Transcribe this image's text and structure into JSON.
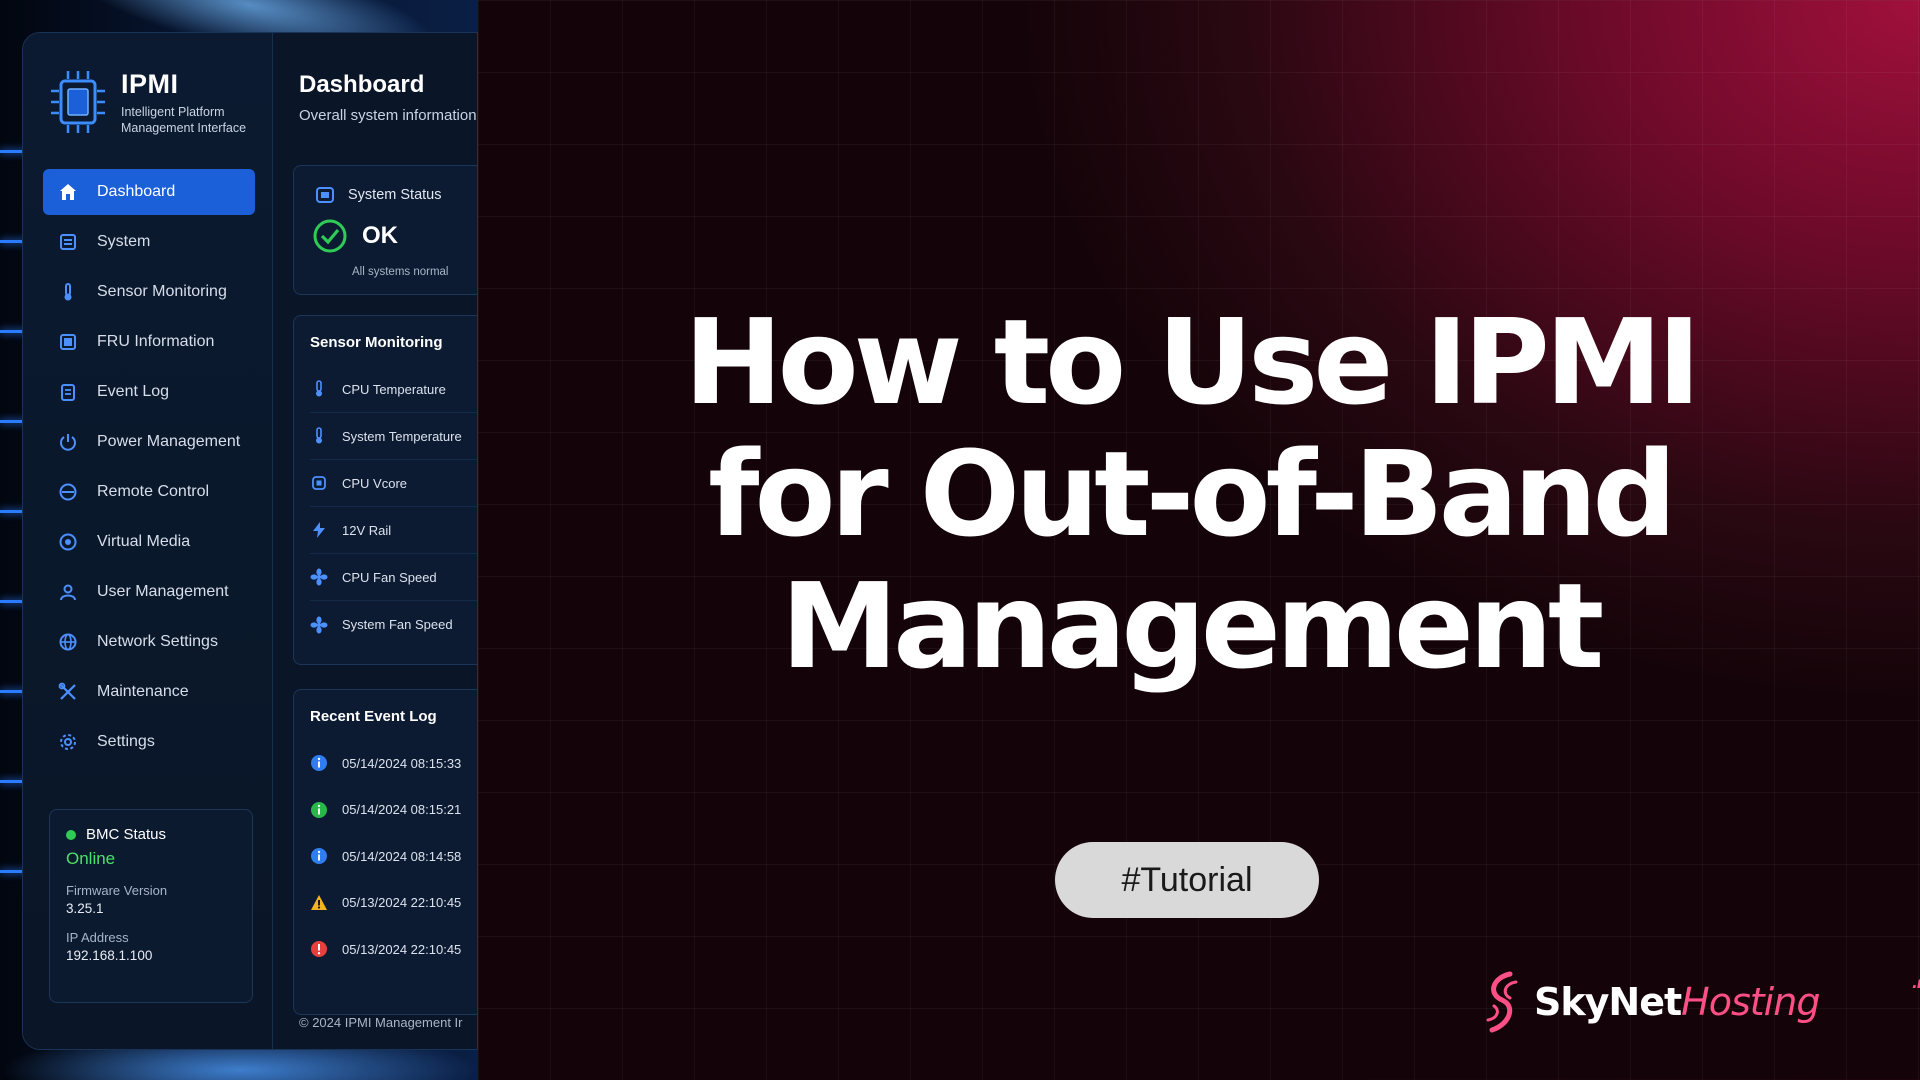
{
  "sidebar": {
    "brand_title": "IPMI",
    "brand_sub_1": "Intelligent Platform",
    "brand_sub_2": "Management Interface",
    "items": [
      {
        "label": "Dashboard",
        "icon": "home-icon"
      },
      {
        "label": "System",
        "icon": "system-icon"
      },
      {
        "label": "Sensor Monitoring",
        "icon": "sensor-icon"
      },
      {
        "label": "FRU Information",
        "icon": "fru-icon"
      },
      {
        "label": "Event Log",
        "icon": "event-log-icon"
      },
      {
        "label": "Power Management",
        "icon": "power-icon"
      },
      {
        "label": "Remote Control",
        "icon": "remote-control-icon"
      },
      {
        "label": "Virtual Media",
        "icon": "virtual-media-icon"
      },
      {
        "label": "User Management",
        "icon": "user-icon"
      },
      {
        "label": "Network Settings",
        "icon": "network-icon"
      },
      {
        "label": "Maintenance",
        "icon": "maintenance-icon"
      },
      {
        "label": "Settings",
        "icon": "gear-icon"
      }
    ],
    "bmc": {
      "title": "BMC Status",
      "status": "Online",
      "fw_label": "Firmware Version",
      "fw_value": "3.25.1",
      "ip_label": "IP Address",
      "ip_value": "192.168.1.100"
    }
  },
  "main": {
    "title": "Dashboard",
    "subtitle": "Overall system information",
    "system_status": {
      "label": "System Status",
      "value": "OK",
      "note": "All systems normal"
    },
    "sensor_title": "Sensor Monitoring",
    "sensors": [
      {
        "label": "CPU Temperature",
        "icon": "thermometer-icon"
      },
      {
        "label": "System Temperature",
        "icon": "thermometer-icon"
      },
      {
        "label": "CPU Vcore",
        "icon": "chip-icon"
      },
      {
        "label": "12V Rail",
        "icon": "bolt-icon"
      },
      {
        "label": "CPU Fan Speed",
        "icon": "fan-icon"
      },
      {
        "label": "System Fan Speed",
        "icon": "fan-icon"
      }
    ],
    "event_title": "Recent Event Log",
    "events": [
      {
        "time": "05/14/2024 08:15:33",
        "level": "info"
      },
      {
        "time": "05/14/2024 08:15:21",
        "level": "success"
      },
      {
        "time": "05/14/2024 08:14:58",
        "level": "info"
      },
      {
        "time": "05/13/2024 22:10:45",
        "level": "warning"
      },
      {
        "time": "05/13/2024 22:10:45",
        "level": "error"
      }
    ],
    "footer": "© 2024 IPMI Management Ir"
  },
  "headline": {
    "line1": "How to Use IPMI",
    "line2": "for Out-of-Band",
    "line3": "Management"
  },
  "tag": "#Tutorial",
  "logo": {
    "sky": "SkyNet",
    "hosting": "Hosting",
    "net": ".net"
  },
  "colors": {
    "accent": "#1b5fd9",
    "online": "#4be06b",
    "brand_pink": "#ff4f86"
  }
}
